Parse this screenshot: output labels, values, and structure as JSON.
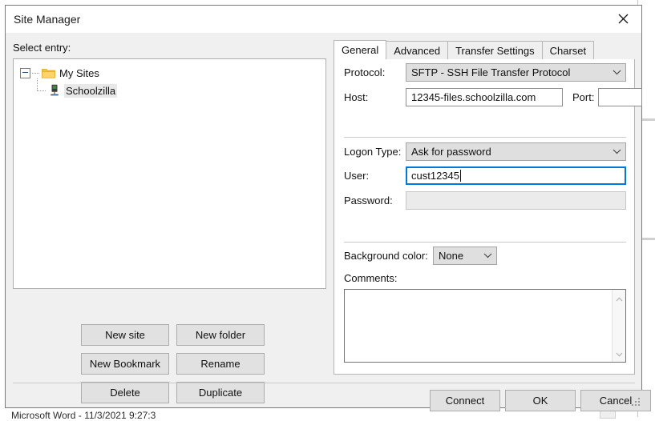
{
  "window": {
    "title": "Site Manager",
    "close_icon": "close-icon"
  },
  "background": {
    "document_line": "Microsoft Word - 11/3/2021 9:27:3"
  },
  "left_pane": {
    "select_entry_label": "Select entry:",
    "tree": [
      {
        "label": "My Sites",
        "icon": "folder-icon",
        "expanded": true,
        "selected": false
      },
      {
        "label": "Schoolzilla",
        "icon": "server-icon",
        "expanded": false,
        "selected": true
      }
    ],
    "buttons": {
      "new_site": "New site",
      "new_folder": "New folder",
      "new_bookmark": "New Bookmark",
      "rename": "Rename",
      "delete": "Delete",
      "duplicate": "Duplicate"
    }
  },
  "right_pane": {
    "tabs": [
      {
        "label": "General",
        "active": true
      },
      {
        "label": "Advanced",
        "active": false
      },
      {
        "label": "Transfer Settings",
        "active": false
      },
      {
        "label": "Charset",
        "active": false
      }
    ],
    "general": {
      "protocol_label": "Protocol:",
      "protocol_value": "SFTP - SSH File Transfer Protocol",
      "host_label": "Host:",
      "host_value": "12345-files.schoolzilla.com",
      "port_label": "Port:",
      "port_value": "",
      "logon_type_label": "Logon Type:",
      "logon_type_value": "Ask for password",
      "user_label": "User:",
      "user_value": "cust12345",
      "password_label": "Password:",
      "password_value": "",
      "background_color_label": "Background color:",
      "background_color_value": "None",
      "comments_label": "Comments:",
      "comments_value": ""
    }
  },
  "footer": {
    "connect": "Connect",
    "ok": "OK",
    "cancel": "Cancel"
  },
  "colors": {
    "focus_blue": "#0078d7",
    "dialog_bg": "#f0f0f0",
    "button_face": "#e1e1e1",
    "folder_yellow": "#f5c143",
    "server_green": "#3aa648"
  }
}
